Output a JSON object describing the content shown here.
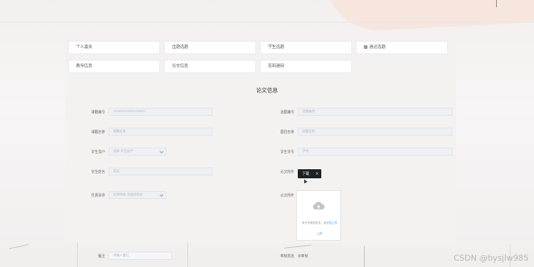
{
  "nav": {
    "items": [
      {
        "label": "个人喜贡",
        "icon": "menu-icon"
      },
      {
        "label": "出题选题",
        "icon": "menu-icon"
      },
      {
        "label": "学生选题",
        "icon": "menu-icon"
      },
      {
        "label": "通过选题",
        "icon": "menu-icon"
      },
      {
        "label": "教导信息",
        "icon": "menu-icon"
      },
      {
        "label": "论文信息",
        "icon": "menu-icon"
      },
      {
        "label": "答辩通知",
        "icon": "menu-icon"
      }
    ]
  },
  "page_title": "论文信息",
  "form": {
    "paper_no": {
      "label": "课题编号",
      "value": "1000000000000000"
    },
    "topic_no": {
      "label": "选题编号",
      "value": "选题编号"
    },
    "paper_name": {
      "label": "课题名称",
      "value": "课题名称"
    },
    "topic_title": {
      "label": "题目名称",
      "value": "选题名称"
    },
    "student_account": {
      "label": "学生用户",
      "value": "选择 学生用户"
    },
    "student_name": {
      "label": "学生学号",
      "value": "学号"
    },
    "student_name2": {
      "label": "学生姓名",
      "value": "姓名"
    },
    "thesis_file": {
      "label": "论文附件"
    },
    "advisor": {
      "label": "负责导师",
      "value": "负责导师 请选择导师"
    },
    "attachment": {
      "label": "论文附件"
    },
    "note": {
      "label": "备注",
      "value": "请输入备注"
    },
    "review_status": {
      "label": "审核状态",
      "value": "未审核"
    }
  },
  "tooltip": {
    "label": "下载",
    "close": "×"
  },
  "upload": {
    "hint": "将文件拖到此处，或",
    "hint_link": "点击上传",
    "link": "上传"
  },
  "watermark": "CSDN @bysjlw985",
  "colors": {
    "accent": "#409eff",
    "tooltip_bg": "#1f2126"
  }
}
